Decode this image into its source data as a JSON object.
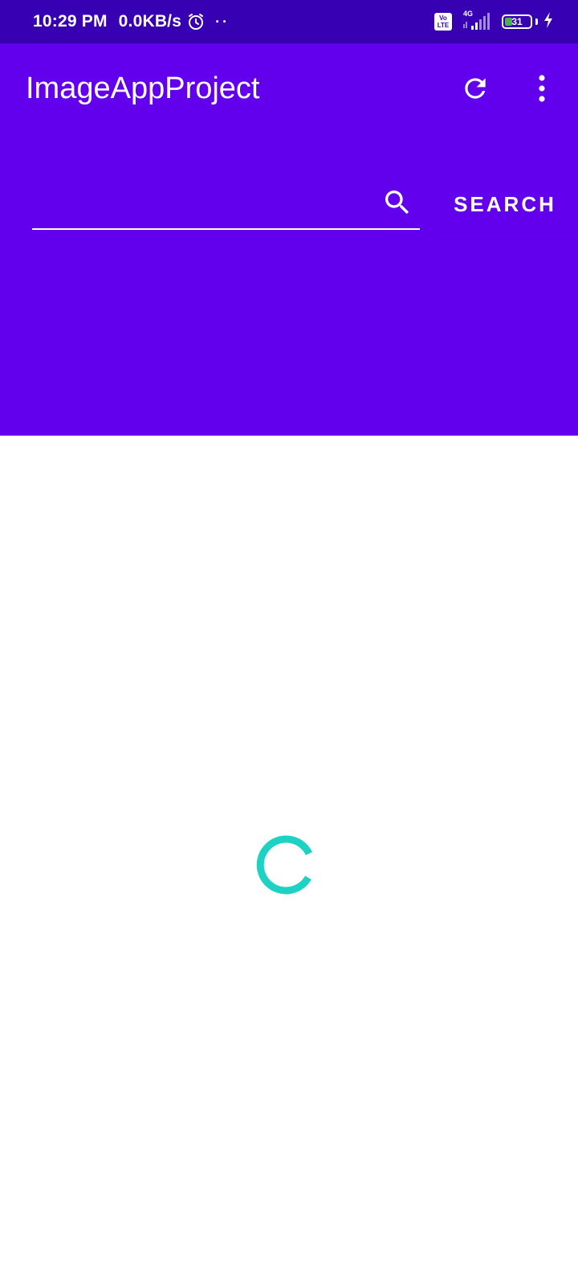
{
  "status_bar": {
    "time": "10:29 PM",
    "network_speed": "0.0KB/s",
    "dots": "··",
    "volte_top": "Vo",
    "volte_bottom": "LTE",
    "network_type": "4G",
    "battery_level": "31",
    "battery_fraction": 0.31,
    "icons": [
      "alarm-icon",
      "volte-icon",
      "signal-icon",
      "battery-icon",
      "charging-icon"
    ]
  },
  "app_bar": {
    "title": "ImageAppProject",
    "actions": [
      "refresh-icon",
      "more-vert-icon"
    ]
  },
  "search": {
    "input_value": "",
    "placeholder": "",
    "icon": "search-icon",
    "button_label": "SEARCH"
  },
  "content": {
    "loading_indicator": "circular-progress-icon"
  },
  "colors": {
    "status_bar": "#3700b3",
    "primary": "#6200ee",
    "on_primary": "#ffffff",
    "spinner": "#1ed2c3",
    "background": "#ffffff",
    "battery_fill": "#4caf50"
  }
}
